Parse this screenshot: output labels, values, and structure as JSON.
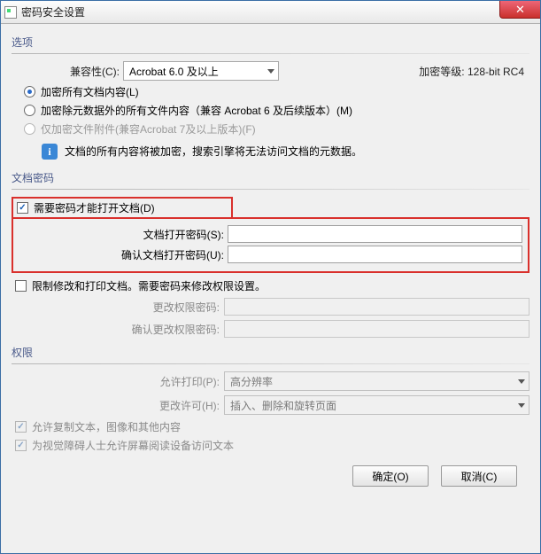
{
  "title": "密码安全设置",
  "close_glyph": "✕",
  "groups": {
    "options_label": "选项",
    "docpw_label": "文档密码",
    "perm_label": "权限"
  },
  "options": {
    "compat_label": "兼容性(C):",
    "compat_value": "Acrobat 6.0 及以上",
    "enc_level_label": "加密等级: 128-bit RC4",
    "radio_all": "加密所有文档内容(L)",
    "radio_except_meta": "加密除元数据外的所有文件内容（兼容 Acrobat 6 及后续版本）(M)",
    "radio_attach_only": "仅加密文件附件(兼容Acrobat 7及以上版本)(F)",
    "info_text": "文档的所有内容将被加密，搜索引擎将无法访问文档的元数据。"
  },
  "docpw": {
    "require_open_pw": "需要密码才能打开文档(D)",
    "open_pw_label": "文档打开密码(S):",
    "confirm_open_pw_label": "确认文档打开密码(U):",
    "restrict_label": "限制修改和打印文档。需要密码来修改权限设置。",
    "change_perm_pw_label": "更改权限密码:",
    "confirm_change_perm_pw_label": "确认更改权限密码:"
  },
  "perm": {
    "allow_print_label": "允许打印(P):",
    "allow_print_value": "高分辨率",
    "allow_changes_label": "更改许可(H):",
    "allow_changes_value": "插入、删除和旋转页面",
    "allow_copy": "允许复制文本，图像和其他内容",
    "allow_screen_reader": "为视觉障碍人士允许屏幕阅读设备访问文本"
  },
  "buttons": {
    "ok": "确定(O)",
    "cancel": "取消(C)"
  },
  "info_glyph": "i"
}
